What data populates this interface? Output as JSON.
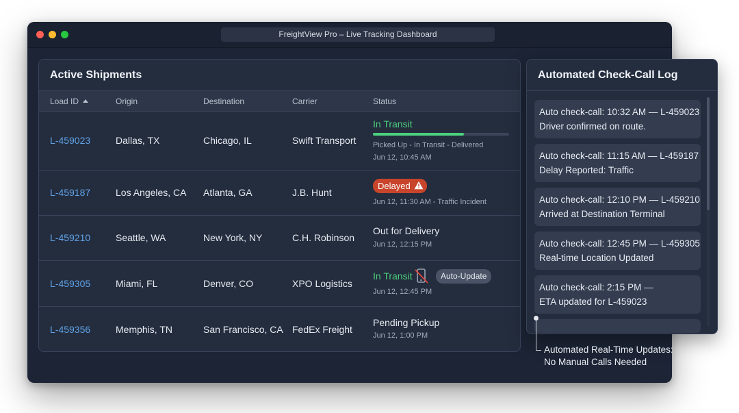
{
  "window": {
    "title": "FreightView Pro – Live Tracking Dashboard"
  },
  "shipments": {
    "title": "Active Shipments",
    "columns": {
      "load_id": "Load ID",
      "origin": "Origin",
      "destination": "Destination",
      "carrier": "Carrier",
      "status": "Status"
    },
    "rows": [
      {
        "load_id": "L-459023",
        "origin": "Dallas, TX",
        "destination": "Chicago, IL",
        "carrier": "Swift Transport",
        "status": "In Transit",
        "progress": 0.67,
        "steps": "Picked Up - In Transit - Delivered",
        "time": "Jun 12, 10:45 AM"
      },
      {
        "load_id": "L-459187",
        "origin": "Los Angeles, CA",
        "destination": "Atlanta, GA",
        "carrier": "J.B. Hunt",
        "status": "Delayed",
        "time": "Jun 12, 11:30 AM - Traffic Incident"
      },
      {
        "load_id": "L-459210",
        "origin": "Seattle, WA",
        "destination": "New York, NY",
        "carrier": "C.H. Robinson",
        "status": "Out for Delivery",
        "time": "Jun 12, 12:15 PM"
      },
      {
        "load_id": "L-459305",
        "origin": "Miami, FL",
        "destination": "Denver, CO",
        "carrier": "XPO Logistics",
        "status": "In Transit",
        "badge": "Auto-Update",
        "time": "Jun 12, 12:45 PM"
      },
      {
        "load_id": "L-459356",
        "origin": "Memphis, TN",
        "destination": "San Francisco, CA",
        "carrier": "FedEx Freight",
        "status": "Pending Pickup",
        "time": "Jun 12, 1:00 PM"
      }
    ]
  },
  "checkcall": {
    "title": "Automated Check-Call Log",
    "entries": [
      {
        "line1": "Auto check-call: 10:32 AM — L-459023",
        "line2": "Driver confirmed on route."
      },
      {
        "line1": "Auto check-call: 11:15 AM — L-459187",
        "line2": "Delay Reported: Traffic"
      },
      {
        "line1": "Auto check-call: 12:10 PM — L-459210",
        "line2": "Arrived at Destination Terminal"
      },
      {
        "line1": "Auto check-call: 12:45 PM — L-459305",
        "line2": "Real-time Location Updated"
      },
      {
        "line1": "Auto check-call: 2:15 PM —",
        "line2": "ETA updated for L-459023"
      }
    ]
  },
  "callout": {
    "line1": "Automated Real-Time Updates:",
    "line2": "No Manual Calls Needed"
  },
  "colors": {
    "accent_link": "#5fa3e8",
    "in_transit": "#4cd07d",
    "delayed": "#c8442b",
    "window_bg": "#1c2435"
  },
  "icons": {
    "sort": "sort-ascending-icon",
    "warning": "warning-triangle-icon",
    "no_phone": "phone-off-icon"
  }
}
